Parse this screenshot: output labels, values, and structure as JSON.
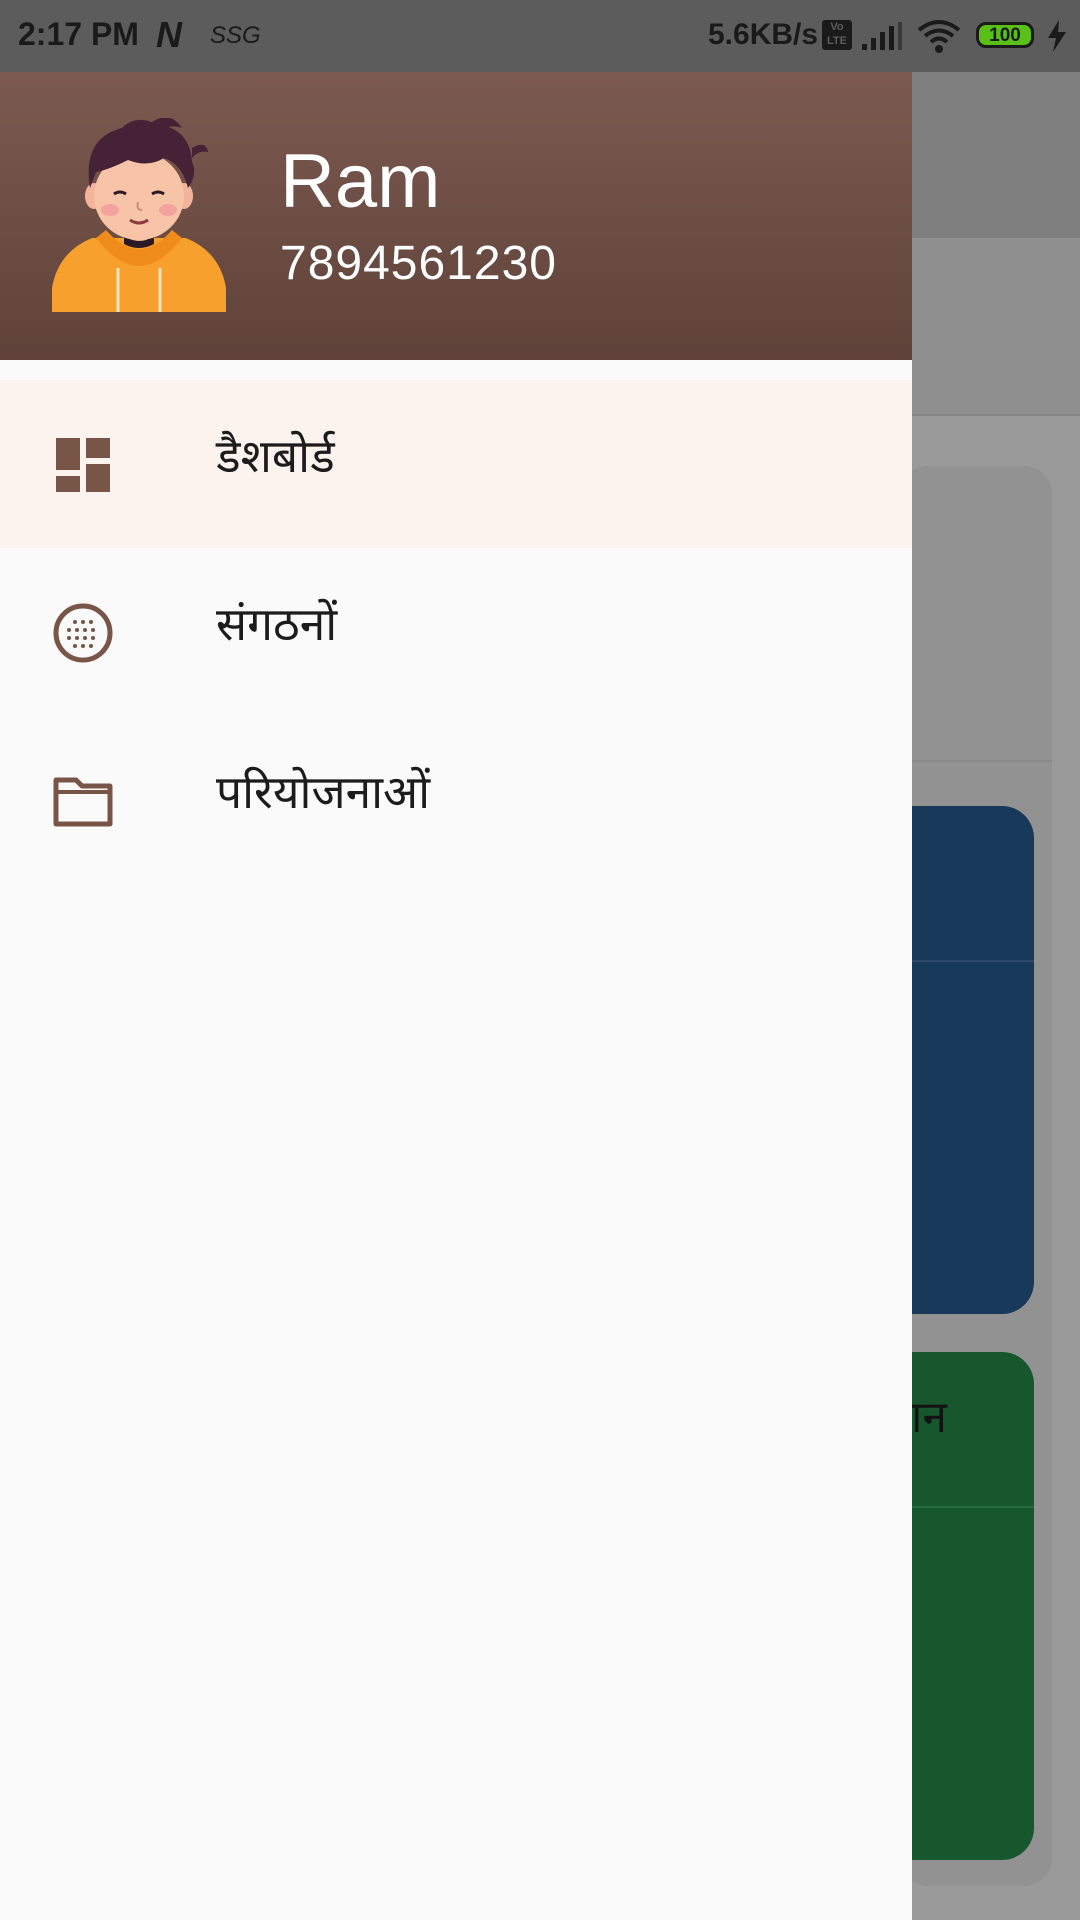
{
  "status_bar": {
    "time": "2:17 PM",
    "n_icon_label": "N",
    "ssg_label": "SSG",
    "network_speed": "5.6KB/s",
    "volte_label": "Vo LTE",
    "battery": "100"
  },
  "drawer": {
    "user": {
      "name": "Ram",
      "phone": "7894561230"
    },
    "items": [
      {
        "label": "डैशबोर्ड",
        "icon": "dashboard-icon",
        "active": true
      },
      {
        "label": "संगठनों",
        "icon": "organization-icon",
        "active": false
      },
      {
        "label": "परियोजनाओं",
        "icon": "folder-icon",
        "active": false
      }
    ]
  },
  "background": {
    "card_partial_text": "धान"
  },
  "colors": {
    "header_top": "#7c5a50",
    "header_bottom": "#5f4239",
    "icon_brown": "#795548",
    "active_item_bg": "#fcf3ef"
  }
}
